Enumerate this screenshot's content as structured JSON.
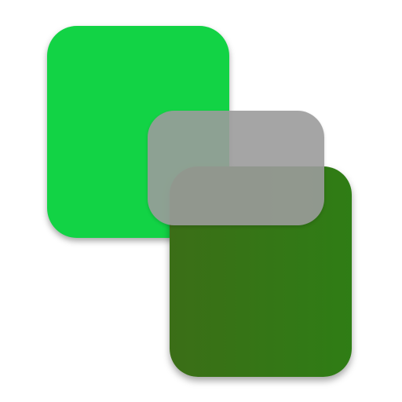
{
  "icon": {
    "colors": {
      "light_green": "#12d345",
      "dark_green_left": "#3b6e17",
      "dark_green_right": "#2f7d15",
      "overlay_gray": "rgba(155,155,155,0.9)"
    }
  }
}
